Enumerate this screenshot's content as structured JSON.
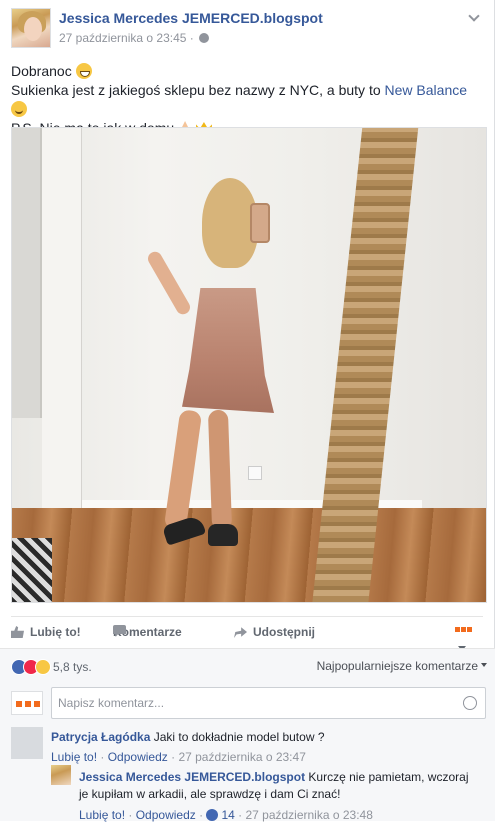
{
  "post": {
    "author": "Jessica Mercedes JEMERCED.blogspot",
    "timestamp": "27 października o 23:45",
    "separator": "·",
    "text_line1": "Dobranoc",
    "text_line2_prefix": "Sukienka jest z jakiegoś sklepu bez nazwy z NYC, a buty to",
    "text_line2_link": "New Balance",
    "text_line3": "P.S. Nie ma to jak w domu"
  },
  "actions": {
    "like_label": "Lubię to!",
    "comment_label": "Komentarze",
    "share_label": "Udostępnij"
  },
  "reactions": {
    "count": "5,8 tys.",
    "sort_label": "Najpopularniejsze komentarze"
  },
  "new_comment": {
    "placeholder": "Napisz komentarz..."
  },
  "comments": [
    {
      "author": "Patrycja Łagódka",
      "text": "Jaki to dokładnie model butow ?",
      "like_label": "Lubię to!",
      "reply_label": "Odpowiedz",
      "timestamp": "27 października o 23:47"
    },
    {
      "author": "Jessica Mercedes JEMERCED.blogspot",
      "text": "Kurczę nie pamietam, wczoraj je kupiłam w arkadii, ale sprawdzę i dam Ci znać!",
      "like_label": "Lubię to!",
      "reply_label": "Odpowiedz",
      "likes": "14",
      "timestamp": "27 października o 23:48"
    }
  ],
  "colors": {
    "link": "#365899",
    "meta": "#90949c",
    "like_blue": "#4267b2",
    "love_red": "#f0284a",
    "wow_yellow": "#f7c744",
    "brand_orange": "#f26b1d"
  },
  "icons": {
    "globe": "globe-icon",
    "chevron": "chevron-down-icon",
    "like": "thumbs-up-icon",
    "comment": "comment-bubble-icon",
    "share": "share-arrow-icon",
    "emoji": "smiley-icon"
  }
}
